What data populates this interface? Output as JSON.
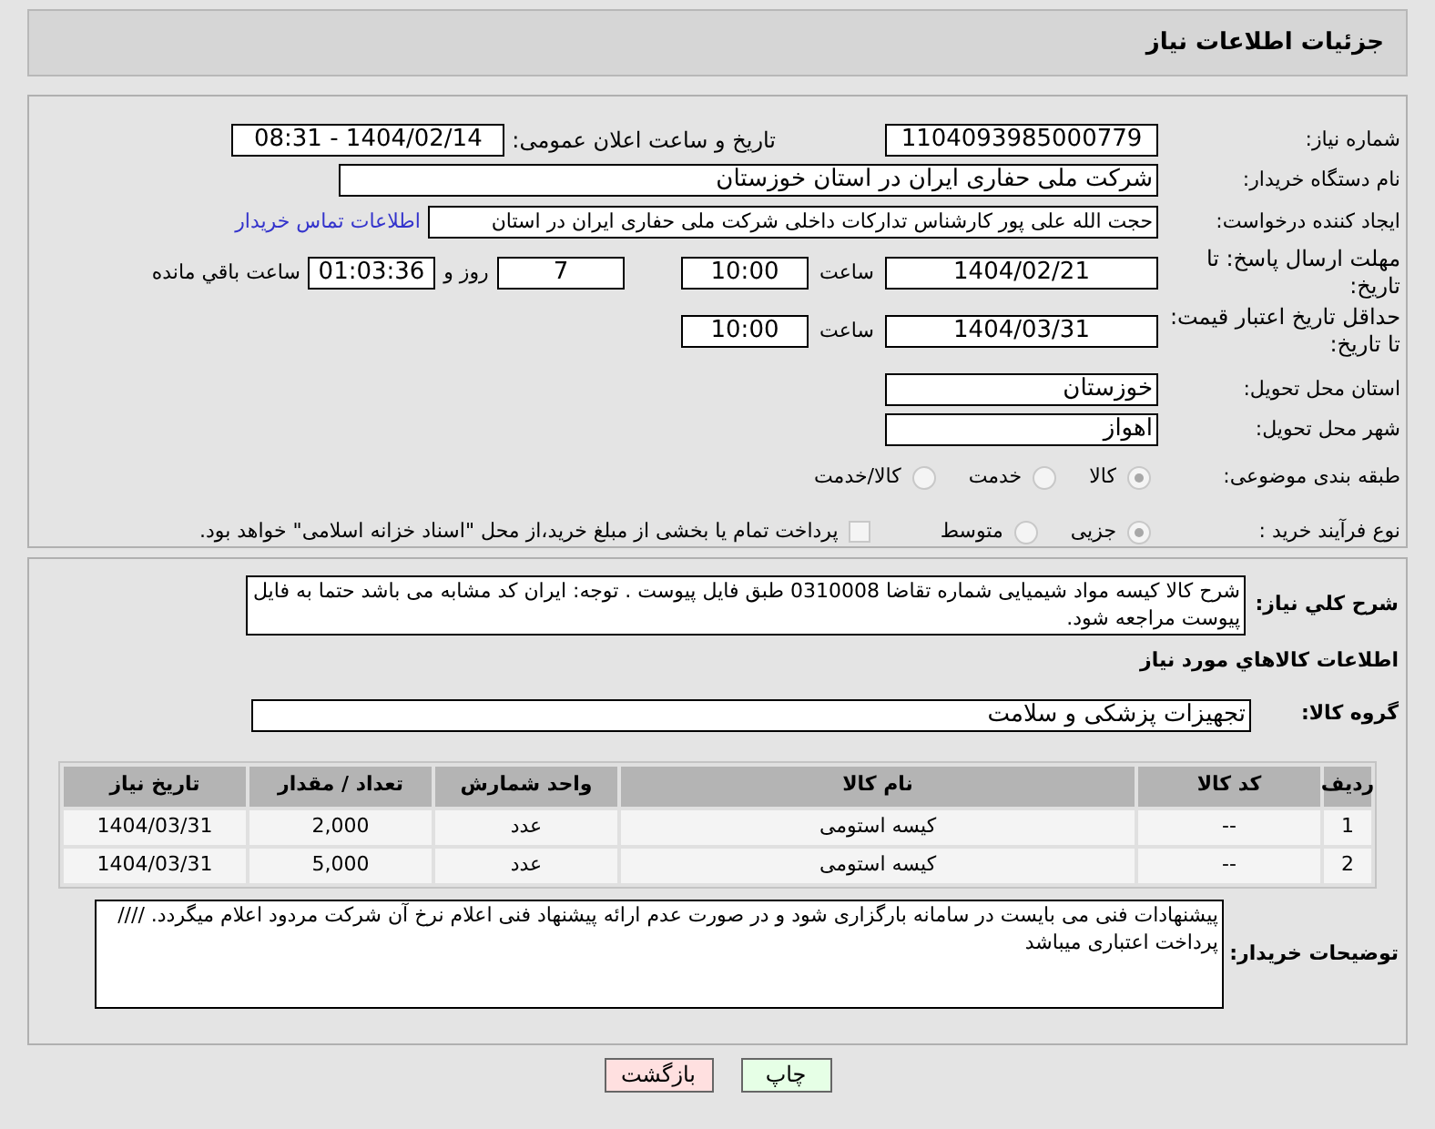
{
  "title": "جزئیات اطلاعات نیاز",
  "need_number": {
    "label": "شماره نیاز:",
    "value": "1104093985000779",
    "announce_label": "تاریخ و ساعت اعلان عمومی:",
    "announce_value": "1404/02/14 - 08:31"
  },
  "buyer": {
    "label": "نام دستگاه خریدار:",
    "value": "شرکت ملی حفاری ایران در استان خوزستان"
  },
  "creator": {
    "label": "ایجاد کننده درخواست:",
    "value": "حجت الله علی پور کارشناس تدارکات داخلی شرکت ملی حفاری ایران در استان",
    "link": "اطلاعات تماس خریدار"
  },
  "deadline": {
    "label": "مهلت ارسال پاسخ: تا تاریخ:",
    "date": "1404/02/21",
    "time_label": "ساعت",
    "time": "10:00",
    "days": "7",
    "days_label": "روز و",
    "remaining": "01:03:36",
    "remaining_label": "ساعت باقي مانده"
  },
  "validity": {
    "label": "حداقل تاریخ اعتبار قیمت: تا تاریخ:",
    "date": "1404/03/31",
    "time_label": "ساعت",
    "time": "10:00"
  },
  "province": {
    "label": "استان محل تحویل:",
    "value": "خوزستان"
  },
  "city": {
    "label": "شهر محل تحویل:",
    "value": "اهواز"
  },
  "category": {
    "label": "طبقه بندی موضوعی:",
    "options": [
      {
        "label": "کالا",
        "selected": true
      },
      {
        "label": "خدمت",
        "selected": false
      },
      {
        "label": "کالا/خدمت",
        "selected": false
      }
    ]
  },
  "process": {
    "label": "نوع فرآیند خرید :",
    "options": [
      {
        "label": "جزیی",
        "selected": true
      },
      {
        "label": "متوسط",
        "selected": false
      }
    ],
    "payment": {
      "label": "پرداخت تمام یا بخشی از مبلغ خرید،از محل \"اسناد خزانه اسلامی\" خواهد بود.",
      "checked": false
    }
  },
  "description": {
    "label": "شرح کلي نياز:",
    "value": "شرح کالا کیسه مواد شیمیایی شماره تقاضا 0310008 طبق فایل پیوست . توجه: ایران کد مشابه می باشد حتما به فایل پیوست مراجعه شود."
  },
  "goods_heading": "اطلاعات کالاهاي مورد نياز",
  "goods_group": {
    "label": "گروه کالا:",
    "value": "تجهیزات پزشکی و سلامت"
  },
  "table": {
    "columns": [
      "ردیف",
      "کد کالا",
      "نام کالا",
      "واحد شمارش",
      "تعداد / مقدار",
      "تاریخ نیاز"
    ],
    "rows": [
      [
        "1",
        "--",
        "کیسه استومی",
        "عدد",
        "2,000",
        "1404/03/31"
      ],
      [
        "2",
        "--",
        "کیسه استومی",
        "عدد",
        "5,000",
        "1404/03/31"
      ]
    ]
  },
  "notes": {
    "label": "توضیحات خریدار:",
    "value": "پیشنهادات فنی می بایست در سامانه بارگزاری شود و در صورت عدم ارائه پیشنهاد فنی اعلام نرخ آن شرکت مردود اعلام میگردد.  //// پرداخت اعتباری میباشد"
  },
  "buttons": [
    {
      "label": "چاپ",
      "kind": "print"
    },
    {
      "label": "بازگشت",
      "kind": "back"
    }
  ]
}
